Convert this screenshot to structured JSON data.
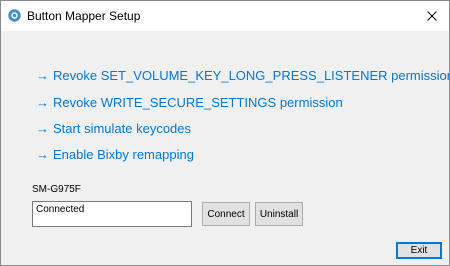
{
  "window": {
    "title": "Button Mapper Setup",
    "icon": "button-mapper-app-icon",
    "close_icon": "close-icon"
  },
  "actions": {
    "arrow": "→",
    "items": [
      {
        "label": "Revoke SET_VOLUME_KEY_LONG_PRESS_LISTENER permission"
      },
      {
        "label": "Revoke WRITE_SECURE_SETTINGS permission"
      },
      {
        "label": "Start simulate keycodes"
      },
      {
        "label": "Enable Bixby remapping"
      }
    ]
  },
  "device": {
    "name": "SM-G975F",
    "status": "Connected",
    "connect_label": "Connect",
    "uninstall_label": "Uninstall"
  },
  "footer": {
    "exit_label": "Exit"
  },
  "colors": {
    "link": "#0078d7",
    "window_bg": "#f0f0f0",
    "titlebar_bg": "#ffffff"
  }
}
